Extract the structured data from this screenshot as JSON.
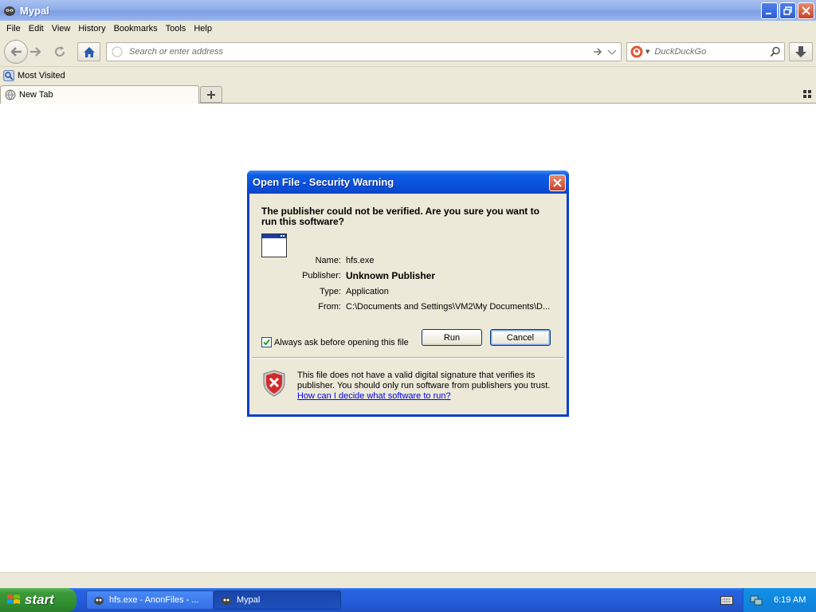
{
  "window": {
    "title": "Mypal"
  },
  "menu": [
    "File",
    "Edit",
    "View",
    "History",
    "Bookmarks",
    "Tools",
    "Help"
  ],
  "navbar": {
    "address_placeholder": "Search or enter address",
    "search_placeholder": "DuckDuckGo"
  },
  "bookmarks": {
    "most_visited": "Most Visited"
  },
  "tabs": {
    "active_tab": "New Tab"
  },
  "dialog": {
    "title": "Open File - Security Warning",
    "question": "The publisher could not be verified.  Are you sure you want to run this software?",
    "fields": {
      "name_label": "Name:",
      "name_value": "hfs.exe",
      "publisher_label": "Publisher:",
      "publisher_value": "Unknown Publisher",
      "type_label": "Type:",
      "type_value": "Application",
      "from_label": "From:",
      "from_value": "C:\\Documents and Settings\\VM2\\My Documents\\D..."
    },
    "run_label": "Run",
    "cancel_label": "Cancel",
    "checkbox_label": "Always ask before opening this file",
    "checkbox_checked": true,
    "warning_text": "This file does not have a valid digital signature that verifies its publisher.  You should only run software from publishers you trust.",
    "warning_link": "How can I decide what software to run?"
  },
  "taskbar": {
    "start_label": "start",
    "tasks": [
      "hfs.exe - AnonFiles - ...",
      "Mypal"
    ],
    "clock": "6:19 AM"
  },
  "colors": {
    "xp_blue": "#0a3fc9",
    "dialog_bg": "#ece9d8",
    "start_green": "#3c9a3a",
    "link_blue": "#0000ee"
  }
}
